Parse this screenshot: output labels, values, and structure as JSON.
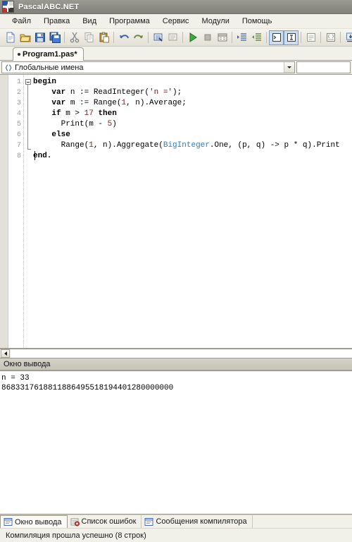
{
  "window": {
    "title": "PascalABC.NET",
    "icon": "app-logo-icon"
  },
  "menu": {
    "items": [
      {
        "label": "Файл"
      },
      {
        "label": "Правка"
      },
      {
        "label": "Вид"
      },
      {
        "label": "Программа"
      },
      {
        "label": "Сервис"
      },
      {
        "label": "Модули"
      },
      {
        "label": "Помощь"
      }
    ]
  },
  "toolbar": {
    "buttons": [
      {
        "name": "new-file-icon",
        "title": "Создать"
      },
      {
        "name": "open-file-icon",
        "title": "Открыть"
      },
      {
        "name": "save-file-icon",
        "title": "Сохранить"
      },
      {
        "name": "save-all-icon",
        "title": "Сохранить все"
      },
      {
        "name": "cut-icon",
        "title": "Вырезать"
      },
      {
        "name": "copy-icon",
        "title": "Копировать"
      },
      {
        "name": "paste-icon",
        "title": "Вставить"
      },
      {
        "name": "undo-icon",
        "title": "Отменить"
      },
      {
        "name": "redo-icon",
        "title": "Вернуть"
      },
      {
        "name": "find-icon",
        "title": "Найти"
      },
      {
        "name": "replace-icon",
        "title": "Заменить"
      },
      {
        "name": "run-icon",
        "title": "Выполнить"
      },
      {
        "name": "stop-icon",
        "title": "Остановить"
      },
      {
        "name": "build-icon",
        "title": "Компилировать"
      },
      {
        "name": "indent-increase-icon",
        "title": "Увеличить отступ"
      },
      {
        "name": "indent-decrease-icon",
        "title": "Уменьшить отступ"
      },
      {
        "name": "toggle-output-window-icon",
        "title": "Окно вывода"
      },
      {
        "name": "toggle-input-window-icon",
        "title": "Окно ввода"
      },
      {
        "name": "toggle-errors-icon",
        "title": "Список ошибок"
      },
      {
        "name": "code-view-icon",
        "title": "Код"
      },
      {
        "name": "step-into-icon",
        "title": "Шаг с заходом"
      },
      {
        "name": "step-over-icon",
        "title": "Шаг с обходом"
      },
      {
        "name": "step-out-icon",
        "title": "Шаг с выходом"
      }
    ]
  },
  "document_tabs": [
    {
      "label": "Program1.pas*",
      "modified": true,
      "active": true
    }
  ],
  "navigation": {
    "scope_combo": {
      "value": "Глобальные имена",
      "icon": "braces-icon"
    },
    "member_combo": {
      "value": ""
    }
  },
  "editor": {
    "line_numbers": [
      "1",
      "2",
      "3",
      "4",
      "5",
      "6",
      "7",
      "8"
    ],
    "lines": [
      {
        "n": "1",
        "tokens": [
          {
            "t": "begin",
            "k": "kw"
          }
        ]
      },
      {
        "n": "2",
        "tokens": [
          {
            "t": "    var ",
            "k": "kw"
          },
          {
            "t": "n := ReadInteger(",
            "k": "pln"
          },
          {
            "t": "'n ='",
            "k": "str"
          },
          {
            "t": ");",
            "k": "pln"
          }
        ]
      },
      {
        "n": "3",
        "tokens": [
          {
            "t": "    var ",
            "k": "kw"
          },
          {
            "t": "m := Range(",
            "k": "pln"
          },
          {
            "t": "1",
            "k": "num"
          },
          {
            "t": ", n).Average;",
            "k": "pln"
          }
        ]
      },
      {
        "n": "4",
        "tokens": [
          {
            "t": "    if ",
            "k": "kw"
          },
          {
            "t": "m > ",
            "k": "pln"
          },
          {
            "t": "17",
            "k": "num"
          },
          {
            "t": " ",
            "k": "pln"
          },
          {
            "t": "then",
            "k": "kw"
          }
        ]
      },
      {
        "n": "5",
        "tokens": [
          {
            "t": "      Print(m - ",
            "k": "pln"
          },
          {
            "t": "5",
            "k": "num"
          },
          {
            "t": ")",
            "k": "pln"
          }
        ]
      },
      {
        "n": "6",
        "tokens": [
          {
            "t": "    else",
            "k": "kw"
          }
        ]
      },
      {
        "n": "7",
        "tokens": [
          {
            "t": "      Range(",
            "k": "pln"
          },
          {
            "t": "1",
            "k": "num"
          },
          {
            "t": ", n).Aggregate(",
            "k": "pln"
          },
          {
            "t": "BigInteger",
            "k": "typ"
          },
          {
            "t": ".One, (p, q) -> p * q).Print",
            "k": "pln"
          }
        ]
      },
      {
        "n": "8",
        "tokens": [
          {
            "t": "end.",
            "k": "kw"
          }
        ]
      }
    ]
  },
  "output_panel": {
    "header": "Окно вывода",
    "lines": [
      "n = 33",
      "8683317618811886495518194401280000000"
    ]
  },
  "bottom_tabs": [
    {
      "label": "Окно вывода",
      "icon": "output-window-icon",
      "active": true
    },
    {
      "label": "Список ошибок",
      "icon": "error-list-icon",
      "active": false
    },
    {
      "label": "Сообщения компилятора",
      "icon": "compiler-messages-icon",
      "active": false
    }
  ],
  "status_bar": {
    "message": "Компиляция прошла успешно (8 строк)"
  },
  "colors": {
    "title_bar": "#8e8e86",
    "chrome": "#f1f0e9",
    "keyword": "#000000",
    "number": "#8a2020",
    "string": "#7a0a0a",
    "type": "#2f7fbf",
    "line_number": "#9a9a9a",
    "tab_active_bg": "#fbfaf6",
    "toolbar_pressed": "#cddcee"
  }
}
